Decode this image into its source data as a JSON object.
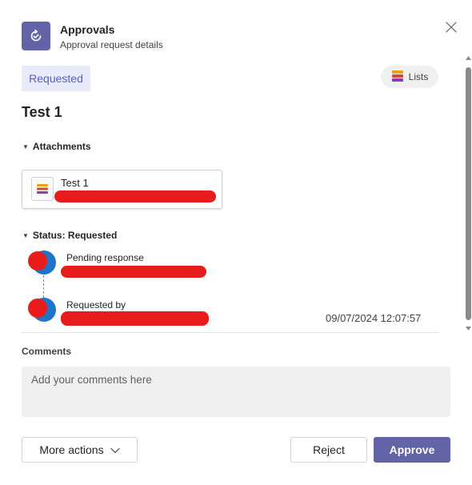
{
  "header": {
    "title": "Approvals",
    "subtitle": "Approval request details",
    "app_icon": "approvals-icon",
    "close_icon": "close-icon"
  },
  "tabs": [
    {
      "label": "Requested",
      "selected": true
    }
  ],
  "lists_chip": {
    "label": "Lists",
    "icon": "lists-icon"
  },
  "request": {
    "title": "Test 1"
  },
  "attachments": {
    "heading": "Attachments",
    "items": [
      {
        "name": "Test 1",
        "icon": "lists-file-icon"
      }
    ]
  },
  "status": {
    "heading": "Status: Requested",
    "entries": [
      {
        "label": "Pending response",
        "timestamp": ""
      },
      {
        "label": "Requested by",
        "timestamp": "09/07/2024 12:07:57"
      }
    ]
  },
  "comments": {
    "label": "Comments",
    "placeholder": "Add your comments here",
    "value": ""
  },
  "footer": {
    "more_actions": "More actions",
    "reject": "Reject",
    "approve": "Approve"
  },
  "colors": {
    "accent": "#6264a7",
    "tab_text": "#5b5fc7",
    "tab_bg": "#e8ebfa",
    "redaction": "#e81c1c",
    "avatar": "#1f73c8"
  }
}
